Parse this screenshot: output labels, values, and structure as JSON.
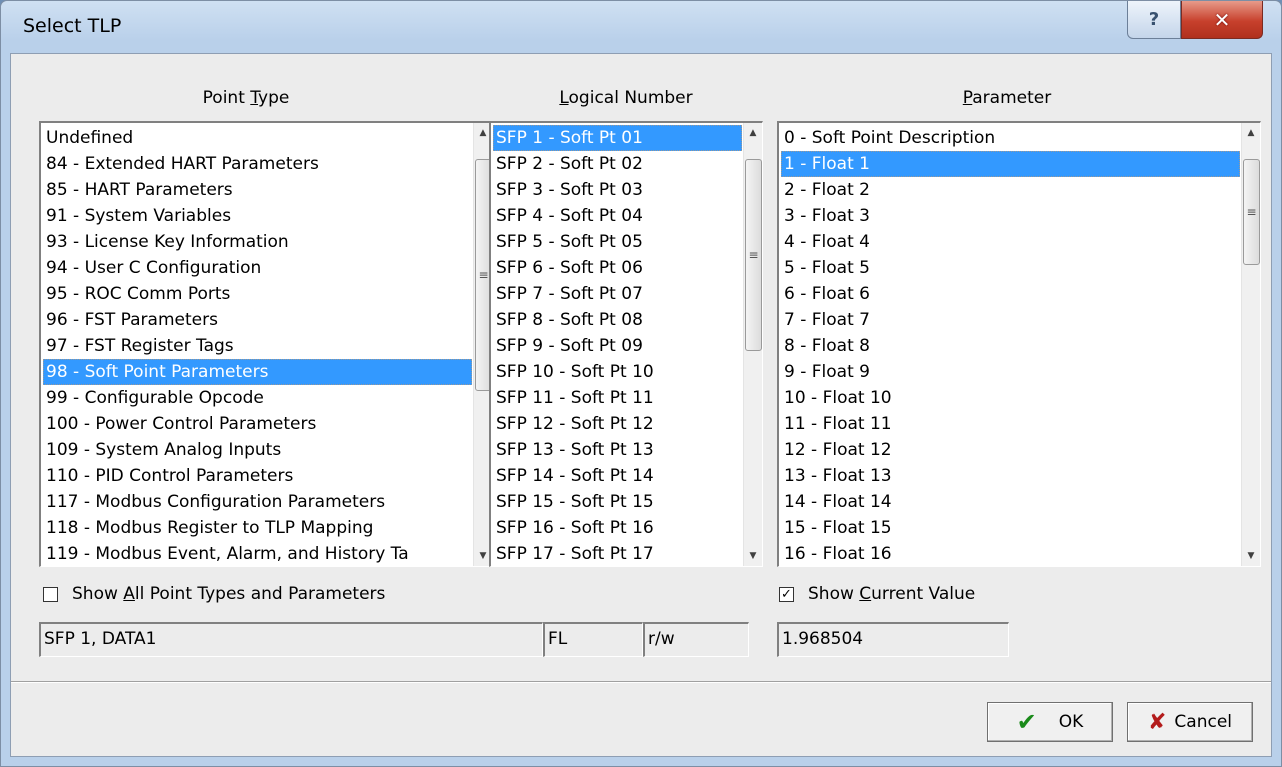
{
  "window": {
    "title": "Select TLP",
    "help_glyph": "?",
    "close_glyph": "✕"
  },
  "columns": {
    "point_type": {
      "label_pre": "Point ",
      "label_key": "T",
      "label_post": "ype"
    },
    "logical_number": {
      "label_pre": "",
      "label_key": "L",
      "label_post": "ogical Number"
    },
    "parameter": {
      "label_pre": "",
      "label_key": "P",
      "label_post": "arameter"
    }
  },
  "point_type_list": {
    "selected_index": 9,
    "items": [
      "Undefined",
      "84 - Extended HART Parameters",
      "85 - HART Parameters",
      "91 - System Variables",
      "93 - License Key Information",
      "94 - User C Configuration",
      "95 - ROC Comm Ports",
      "96 - FST Parameters",
      "97 - FST Register Tags",
      "98 - Soft Point Parameters",
      "99 - Configurable Opcode",
      "100 - Power Control Parameters",
      "109 - System Analog Inputs",
      "110 - PID Control Parameters",
      "117 - Modbus Configuration Parameters",
      "118 - Modbus Register to TLP Mapping",
      "119 - Modbus Event, Alarm, and History Ta"
    ]
  },
  "logical_number_list": {
    "selected_index": 0,
    "items": [
      "SFP 1 - Soft Pt 01",
      "SFP 2 - Soft Pt 02",
      "SFP 3 - Soft Pt 03",
      "SFP 4 - Soft Pt 04",
      "SFP 5 - Soft Pt 05",
      "SFP 6 - Soft Pt 06",
      "SFP 7 - Soft Pt 07",
      "SFP 8 - Soft Pt 08",
      "SFP 9 - Soft Pt 09",
      "SFP 10 - Soft Pt 10",
      "SFP 11 - Soft Pt 11",
      "SFP 12 - Soft Pt 12",
      "SFP 13 - Soft Pt 13",
      "SFP 14 - Soft Pt 14",
      "SFP 15 - Soft Pt 15",
      "SFP 16 - Soft Pt 16",
      "SFP 17 - Soft Pt 17"
    ]
  },
  "parameter_list": {
    "selected_index": 1,
    "items": [
      "0 - Soft Point Description",
      "1 - Float 1",
      "2 - Float 2",
      "3 - Float 3",
      "4 - Float 4",
      "5 - Float 5",
      "6 - Float 6",
      "7 - Float 7",
      "8 - Float 8",
      "9 - Float 9",
      "10 - Float 10",
      "11 - Float 11",
      "12 - Float 12",
      "13 - Float 13",
      "14 - Float 14",
      "15 - Float 15",
      "16 - Float 16"
    ]
  },
  "options": {
    "show_all": {
      "label_pre": "Show ",
      "label_key": "A",
      "label_post": "ll Point Types and Parameters",
      "checked": false
    },
    "show_current": {
      "label_pre": "Show ",
      "label_key": "C",
      "label_post": "urrent Value",
      "checked": true
    }
  },
  "fields": {
    "tlp_name": "SFP 1, DATA1",
    "data_type": "FL",
    "access": "r/w",
    "current_value": "1.968504"
  },
  "buttons": {
    "ok_label": "OK",
    "cancel_label": "Cancel",
    "ok_icon": "check-icon",
    "cancel_icon": "x-icon"
  },
  "colors": {
    "selection": "#3399ff",
    "ok_check": "#1a8a1a",
    "cancel_x": "#b31b1b"
  }
}
